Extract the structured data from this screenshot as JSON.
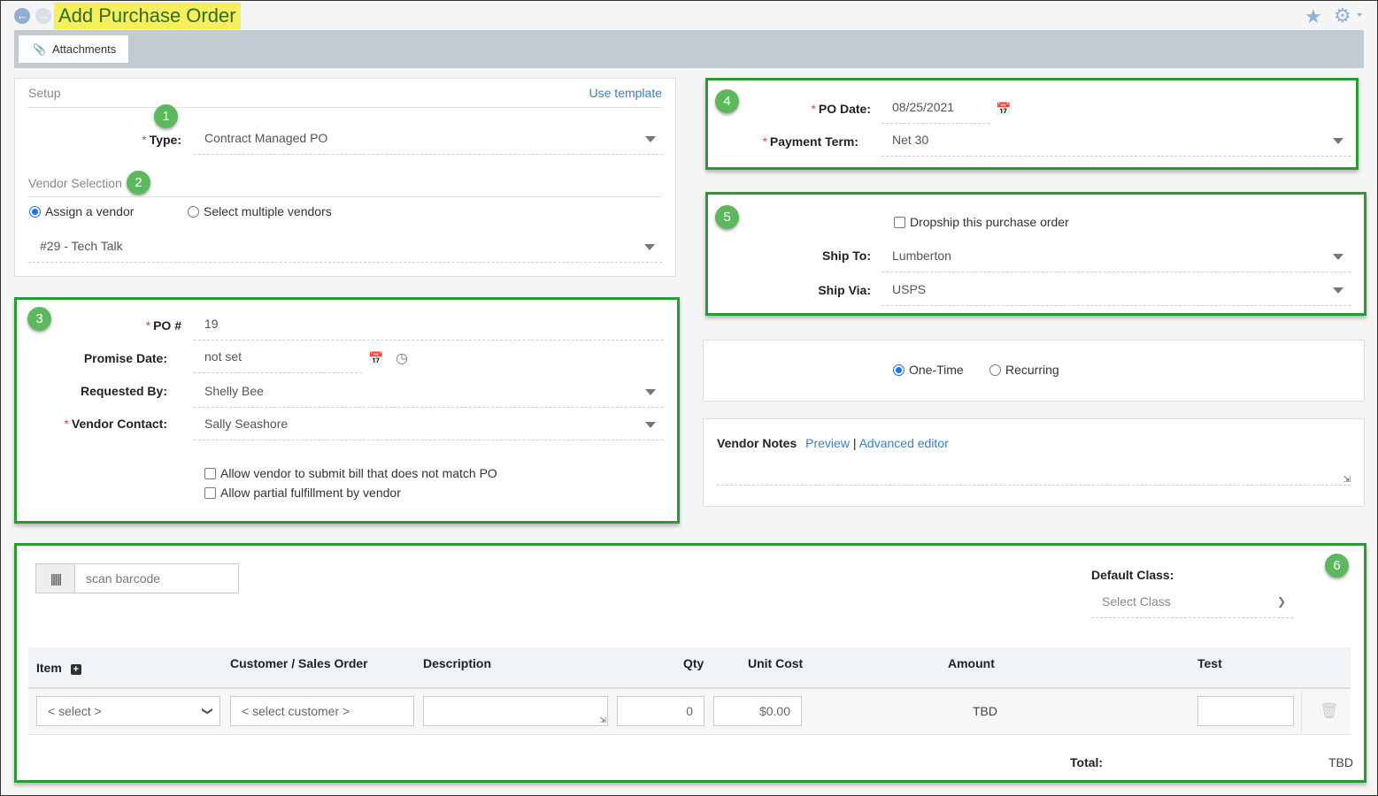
{
  "header": {
    "title": "Add Purchase Order",
    "back_icon": "arrow-left-circle",
    "forward_icon": "arrow-right-circle",
    "favorite_icon": "star",
    "settings_icon": "gear"
  },
  "toolbar": {
    "attachments_label": "Attachments",
    "attachments_icon": "paperclip"
  },
  "badges": [
    "1",
    "2",
    "3",
    "4",
    "5",
    "6"
  ],
  "setup": {
    "section_label": "Setup",
    "use_template_label": "Use template",
    "type_label": "Type:",
    "type_value": "Contract Managed PO",
    "vendor_selection_label": "Vendor Selection",
    "vendor_mode_options": [
      "Assign a vendor",
      "Select multiple vendors"
    ],
    "vendor_mode_selected": "Assign a vendor",
    "vendor_value": "#29 - Tech Talk"
  },
  "po_details": {
    "po_number_label": "PO #",
    "po_number_value": "19",
    "promise_date_label": "Promise Date:",
    "promise_date_value": "not set",
    "requested_by_label": "Requested By:",
    "requested_by_value": "Shelly Bee",
    "vendor_contact_label": "Vendor Contact:",
    "vendor_contact_value": "Sally Seashore",
    "checkbox_bill_mismatch": "Allow vendor to submit bill that does not match PO",
    "checkbox_partial_fulfillment": "Allow partial fulfillment by vendor"
  },
  "dates": {
    "po_date_label": "PO Date:",
    "po_date_value": "08/25/2021",
    "payment_term_label": "Payment Term:",
    "payment_term_value": "Net 30"
  },
  "shipping": {
    "dropship_label": "Dropship this purchase order",
    "ship_to_label": "Ship To:",
    "ship_to_value": "Lumberton",
    "ship_via_label": "Ship Via:",
    "ship_via_value": "USPS"
  },
  "frequency": {
    "options": [
      "One-Time",
      "Recurring"
    ],
    "selected": "One-Time"
  },
  "vendor_notes": {
    "label": "Vendor Notes",
    "preview_label": "Preview",
    "separator": "|",
    "advanced_editor_label": "Advanced editor",
    "value": ""
  },
  "line_items": {
    "barcode_placeholder": "scan barcode",
    "default_class_label": "Default Class:",
    "default_class_value": "Select Class",
    "columns": [
      "Item",
      "Customer / Sales Order",
      "Description",
      "Qty",
      "Unit Cost",
      "Amount",
      "Test"
    ],
    "rows": [
      {
        "item": "< select >",
        "customer": "< select customer >",
        "description": "",
        "qty": "0",
        "unit_cost": "$0.00",
        "amount": "TBD",
        "test": ""
      }
    ],
    "total_label": "Total:",
    "total_value": "TBD"
  }
}
